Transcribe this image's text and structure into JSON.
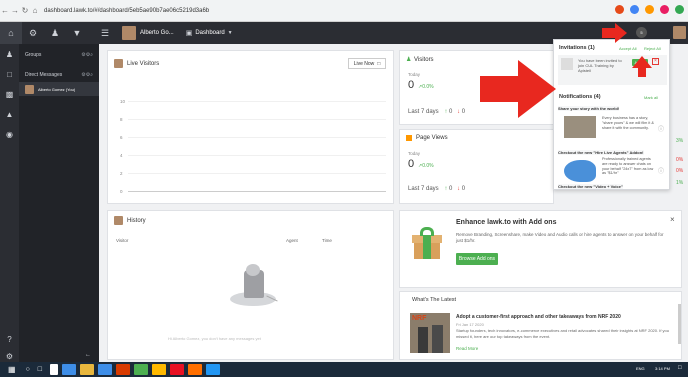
{
  "browser": {
    "url": "dashboard.lawk.to/#/dashboard/5eb5ae90b7ae06c5219d3a6b",
    "ext_colors": [
      "#e64a19",
      "#4285f4",
      "#ff9800",
      "#e91e63",
      "#34a853"
    ]
  },
  "topbar": {
    "user_name": "Alberto Go...",
    "dashboard_label": "Dashboard",
    "notification_count": "5"
  },
  "panel": {
    "groups_label": "Groups",
    "direct_messages_label": "Direct Messages",
    "user_label": "Alberto Gomez (You)"
  },
  "live_visitors": {
    "title": "Live Visitors",
    "live_now_label": "Live Now",
    "y_ticks": [
      "10",
      "8",
      "6",
      "4",
      "2",
      "0"
    ]
  },
  "visitors_card": {
    "title": "Visitors",
    "today_label": "Today",
    "value": "0",
    "pct": "0.0%",
    "last7_label": "Last 7 days",
    "up_val": "0",
    "down_val": "0"
  },
  "pageviews_card": {
    "title": "Page Views",
    "today_label": "Today",
    "value": "0",
    "pct": "0.0%",
    "last7_label": "Last 7 days",
    "up_val": "0",
    "down_val": "0"
  },
  "history": {
    "title": "History",
    "col_visitor": "Visitor",
    "col_agent": "Agent",
    "col_time": "Time",
    "empty_text": "Hi Alberto Gomez, you don't have any messages yet"
  },
  "addons": {
    "title": "Enhance lawk.to with Add ons",
    "desc": "Remove Branding, Screenshare, make Video and Audio calls or hire agents to answer on your behalf for just $1/hr.",
    "button_label": "Browse Add ons"
  },
  "latest": {
    "title": "What's The Latest",
    "thumb_label": "NRF",
    "article_title": "Adopt a customer-first approach and other takeaways from NRF 2020",
    "article_date": "Fri Jan 17 2020",
    "article_desc": "Startup founders, tech innovators, e-commerce executives and retail advocates shared their insights at NRF 2020. If you missed it, here are our top takeaways from the event.",
    "read_more": "Read More"
  },
  "popup": {
    "invitations_title": "Invitations (1)",
    "accept_all": "Accept All",
    "reject_all": "Reject All",
    "invite_text": "You have been invited to join CUL Training by Apisteil",
    "accept_label": "Accept",
    "notifications_title": "Notifications (4)",
    "mark_label": "Mark all",
    "n1_head": "Share your story with the world!",
    "n1_text": "Every business has a story, \"share yours\" & we will film it & share it with the community.",
    "n2_head": "Checkout the new \"Hire Live Agents\" Addon!",
    "n2_text": "Professionally trained agents are ready to answer chats on your behalf \"24x7\" from as low as \"$1/hr\"",
    "n3_head": "Checkout the new \"Video + Voice\""
  },
  "edge_values": [
    "3%",
    "0%",
    "0%",
    "1%"
  ],
  "taskbar": {
    "colors": [
      "#ffffff",
      "#3e8ee8",
      "#e8b73e",
      "#3e8ee8",
      "#d83b01",
      "#4caf50",
      "#ffb900",
      "#e81123",
      "#ff6f00",
      "#2196f3"
    ],
    "lang": "ENG",
    "time": "3:14 PM"
  }
}
